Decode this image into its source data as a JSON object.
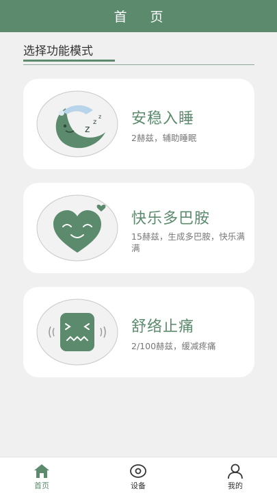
{
  "header": {
    "title": "首 页"
  },
  "section": {
    "title": "选择功能模式"
  },
  "modes": [
    {
      "title": "安稳入睡",
      "subtitle": "2赫兹，辅助睡眠",
      "icon": "sleeping-moon-icon"
    },
    {
      "title": "快乐多巴胺",
      "subtitle": "15赫兹，生成多巴胺，快乐满满",
      "icon": "smiling-heart-icon"
    },
    {
      "title": "舒络止痛",
      "subtitle": "2/100赫兹，缓减疼痛",
      "icon": "pain-face-icon"
    }
  ],
  "tabbar": {
    "active": "home",
    "items": [
      {
        "label": "首页",
        "icon": "home-icon"
      },
      {
        "label": "设备",
        "icon": "device-icon"
      },
      {
        "label": "我的",
        "icon": "user-icon"
      }
    ]
  },
  "colors": {
    "accent": "#5b8a6c",
    "background": "#f0f0f0",
    "card": "#ffffff"
  }
}
